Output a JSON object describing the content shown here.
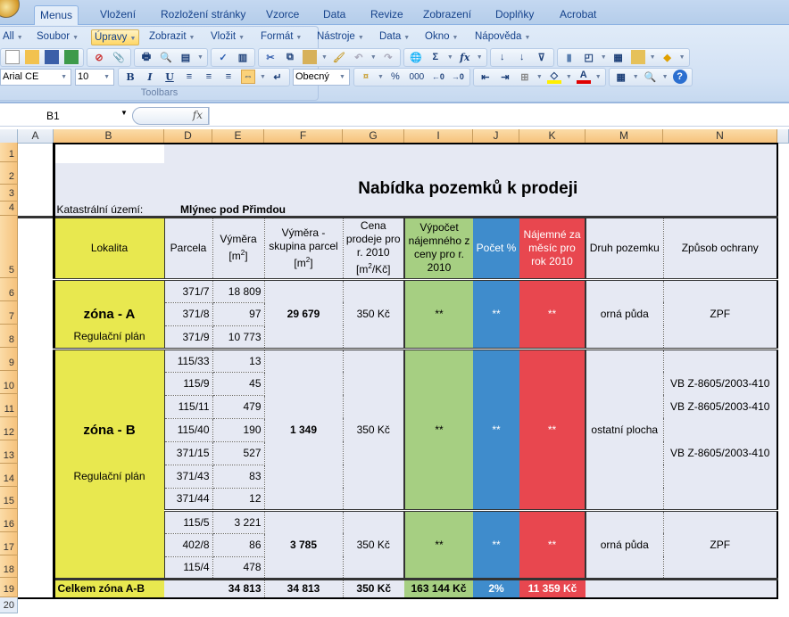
{
  "tabs": [
    "Menus",
    "Vložení",
    "Rozložení stránky",
    "Vzorce",
    "Data",
    "Revize",
    "Zobrazení",
    "Doplňky",
    "Acrobat"
  ],
  "menus": [
    "All",
    "Soubor",
    "Úpravy",
    "Zobrazit",
    "Vložit",
    "Formát",
    "Nástroje",
    "Data",
    "Okno",
    "Nápověda"
  ],
  "toolbar": {
    "font": "Arial CE",
    "size": "10",
    "number_format": "Obecný",
    "group_label": "Toolbars",
    "bold": "B",
    "italic": "I",
    "underline": "U",
    "percent": "%",
    "thousands": "000",
    "sum": "Σ",
    "fx": "fx"
  },
  "formula_bar": {
    "name_box": "B1",
    "fx": "fx",
    "value": ""
  },
  "columns": [
    "A",
    "B",
    "D",
    "E",
    "F",
    "G",
    "I",
    "J",
    "K",
    "M",
    "N"
  ],
  "rows": [
    "1",
    "2",
    "3",
    "4",
    "5",
    "6",
    "7",
    "8",
    "9",
    "10",
    "11",
    "12",
    "13",
    "14",
    "15",
    "16",
    "17",
    "18",
    "19",
    "20"
  ],
  "title": "Nabídka pozemků k prodeji",
  "cadastral_label": "Katastrální území:",
  "cadastral_value": "Mlýnec pod Přimdou",
  "header": {
    "lokalita": "Lokalita",
    "parcela": "Parcela",
    "vymera": "Výměra [m2]",
    "vymera_skupina": "Výměra - skupina parcel [m2]",
    "cena": "Cena prodeje pro r. 2010 [m2/Kč]",
    "vypocet": "Výpočet nájemného z ceny pro r. 2010",
    "pocet": "Počet %",
    "najemne": "Nájemné za měsíc pro rok 2010",
    "druh": "Druh pozemku",
    "zpusob": "Způsob ochrany"
  },
  "zone_a": {
    "name": "zóna - A",
    "plan": "Regulační plán",
    "parcels": [
      {
        "p": "371/7",
        "v": "18 809"
      },
      {
        "p": "371/8",
        "v": "97"
      },
      {
        "p": "371/9",
        "v": "10 773"
      }
    ],
    "group_area": "29 679",
    "price": "350 Kč",
    "calc": "**",
    "pct": "**",
    "rent": "**",
    "kind": "orná půda",
    "protection": "ZPF"
  },
  "zone_b": {
    "name": "zóna - B",
    "plan": "Regulační plán",
    "parcels": [
      {
        "p": "115/33",
        "v": "13",
        "n": ""
      },
      {
        "p": "115/9",
        "v": "45",
        "n": "VB Z-8605/2003-410"
      },
      {
        "p": "115/11",
        "v": "479",
        "n": "VB Z-8605/2003-410"
      },
      {
        "p": "115/40",
        "v": "190",
        "n": ""
      },
      {
        "p": "371/15",
        "v": "527",
        "n": "VB Z-8605/2003-410"
      },
      {
        "p": "371/43",
        "v": "83",
        "n": ""
      },
      {
        "p": "371/44",
        "v": "12",
        "n": ""
      }
    ],
    "group_area": "1 349",
    "price": "350 Kč",
    "calc": "**",
    "pct": "**",
    "rent": "**",
    "kind": "ostatní plocha",
    "sub": {
      "parcels": [
        {
          "p": "115/5",
          "v": "3 221"
        },
        {
          "p": "402/8",
          "v": "86"
        },
        {
          "p": "115/4",
          "v": "478"
        }
      ],
      "group_area": "3 785",
      "price": "350 Kč",
      "calc": "**",
      "pct": "**",
      "rent": "**",
      "kind": "orná půda",
      "protection": "ZPF"
    }
  },
  "total": {
    "label": "Celkem zóna A-B",
    "area": "34 813",
    "group_area": "34 813",
    "price": "350 Kč",
    "calc": "163 144 Kč",
    "pct": "2%",
    "rent": "11 359 Kč"
  },
  "colors": {
    "yellow": "#e8e84f",
    "green": "#a6cf82",
    "blue": "#3f8ccc",
    "red": "#e8474f",
    "sheet_bg": "#e6e9f3"
  }
}
